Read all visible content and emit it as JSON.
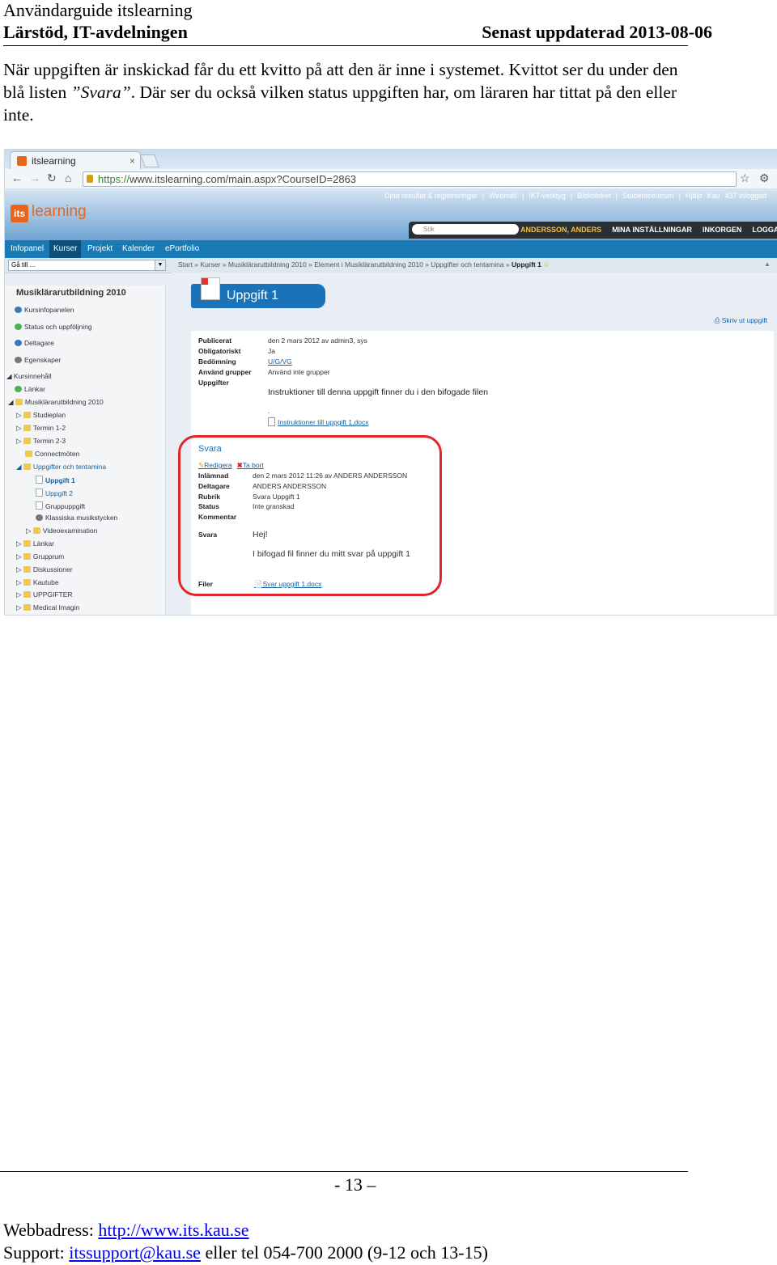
{
  "header": {
    "title": "Användarguide itslearning",
    "department": "Lärstöd, IT-avdelningen",
    "updated": "Senast uppdaterad 2013-08-06"
  },
  "intro": {
    "part1": "När uppgiften är inskickad får du ett kvitto på att den är inne i systemet. Kvittot ser du under den blå listen ",
    "em": "”Svara”",
    "part2": ". Där ser du också vilken status uppgiften har, om läraren har tittat på den eller inte."
  },
  "browser": {
    "tab_title": "itslearning",
    "tab_close": "×",
    "url_https": "https://",
    "url_rest": "www.itslearning.com/main.aspx?CourseID=2863"
  },
  "site": {
    "logo_box": "its",
    "logo_text": "learning",
    "top_links": [
      "Dina resultat & registreringar",
      "|",
      "Webmail",
      "|",
      "IKT-verktyg",
      "|",
      "Biblioteket",
      "|",
      "Studentcentrum",
      "|",
      "Hjälp",
      "Kau",
      "437 inloggad"
    ],
    "search_placeholder": "Sök",
    "user_name": "ANDERSSON, ANDERS",
    "user_links": [
      "MINA INSTÄLLNINGAR",
      "INKORGEN",
      "LOGGA UT"
    ],
    "nav": [
      "Infopanel",
      "Kurser",
      "Projekt",
      "Kalender",
      "ePortfolio"
    ],
    "goto": "Gå till ...",
    "breadcrumb": "Start » Kurser » Musiklärarutbildning 2010 » Element i Musiklärarutbildning 2010 » Uppgifter och tentamina »",
    "breadcrumb_current": "Uppgift 1"
  },
  "sidebar": {
    "course": "Musiklärarutbildning 2010",
    "items": [
      "Kursinfopanelen",
      "Status och uppföljning",
      "Deltagare",
      "Egenskaper",
      "Kursinnehåll",
      "Länkar",
      "Musiklärarutbildning 2010",
      "Studieplan",
      "Termin 1-2",
      "Termin 2-3",
      "Connectmöten",
      "Uppgifter och tentamina",
      "Uppgift 1",
      "Uppgift 2",
      "Gruppuppgift",
      "Klassiska musikstycken",
      "Videoexamination",
      "Länkar",
      "Grupprum",
      "Diskussioner",
      "Kautube",
      "UPPGIFTER",
      "Medical Imagin"
    ]
  },
  "assignment": {
    "title": "Uppgift 1",
    "print_link": "Skriv ut uppgift",
    "labels": [
      "Publicerat",
      "Obligatoriskt",
      "Bedömning",
      "Använd grupper",
      "Uppgifter"
    ],
    "values": [
      "den 2 mars 2012 av admin3, sys",
      "Ja",
      "U/G/VG",
      "Använd inte grupper"
    ],
    "instructions": "Instruktioner till denna uppgift finner du i den bifogade filen",
    "dot": ".",
    "attachment": "Instruktioner till uppgift 1.docx"
  },
  "response": {
    "heading": "Svara",
    "edit": "Redigera",
    "delete": "Ta bort",
    "labels": [
      "Inlämnad",
      "Deltagare",
      "Rubrik",
      "Status",
      "Kommentar",
      "Svara",
      "Filer"
    ],
    "submitted": "den 2 mars 2012 11:26 av ANDERS ANDERSSON",
    "participant": "ANDERS ANDERSSON",
    "subject": "Svara Uppgift 1",
    "status": "Inte granskad",
    "greeting": "Hej!",
    "message": "I bifogad fil finner du mitt svar på uppgift 1",
    "file": "Svar uppgift 1.docx"
  },
  "footer": {
    "page": "- 13 –",
    "web_label": "Webbadress: ",
    "web_url": "http://www.its.kau.se",
    "support_label": "Support: ",
    "support_email": "itssupport@kau.se",
    "support_rest": " eller tel 054-700 2000 (9-12 och 13-15)"
  }
}
